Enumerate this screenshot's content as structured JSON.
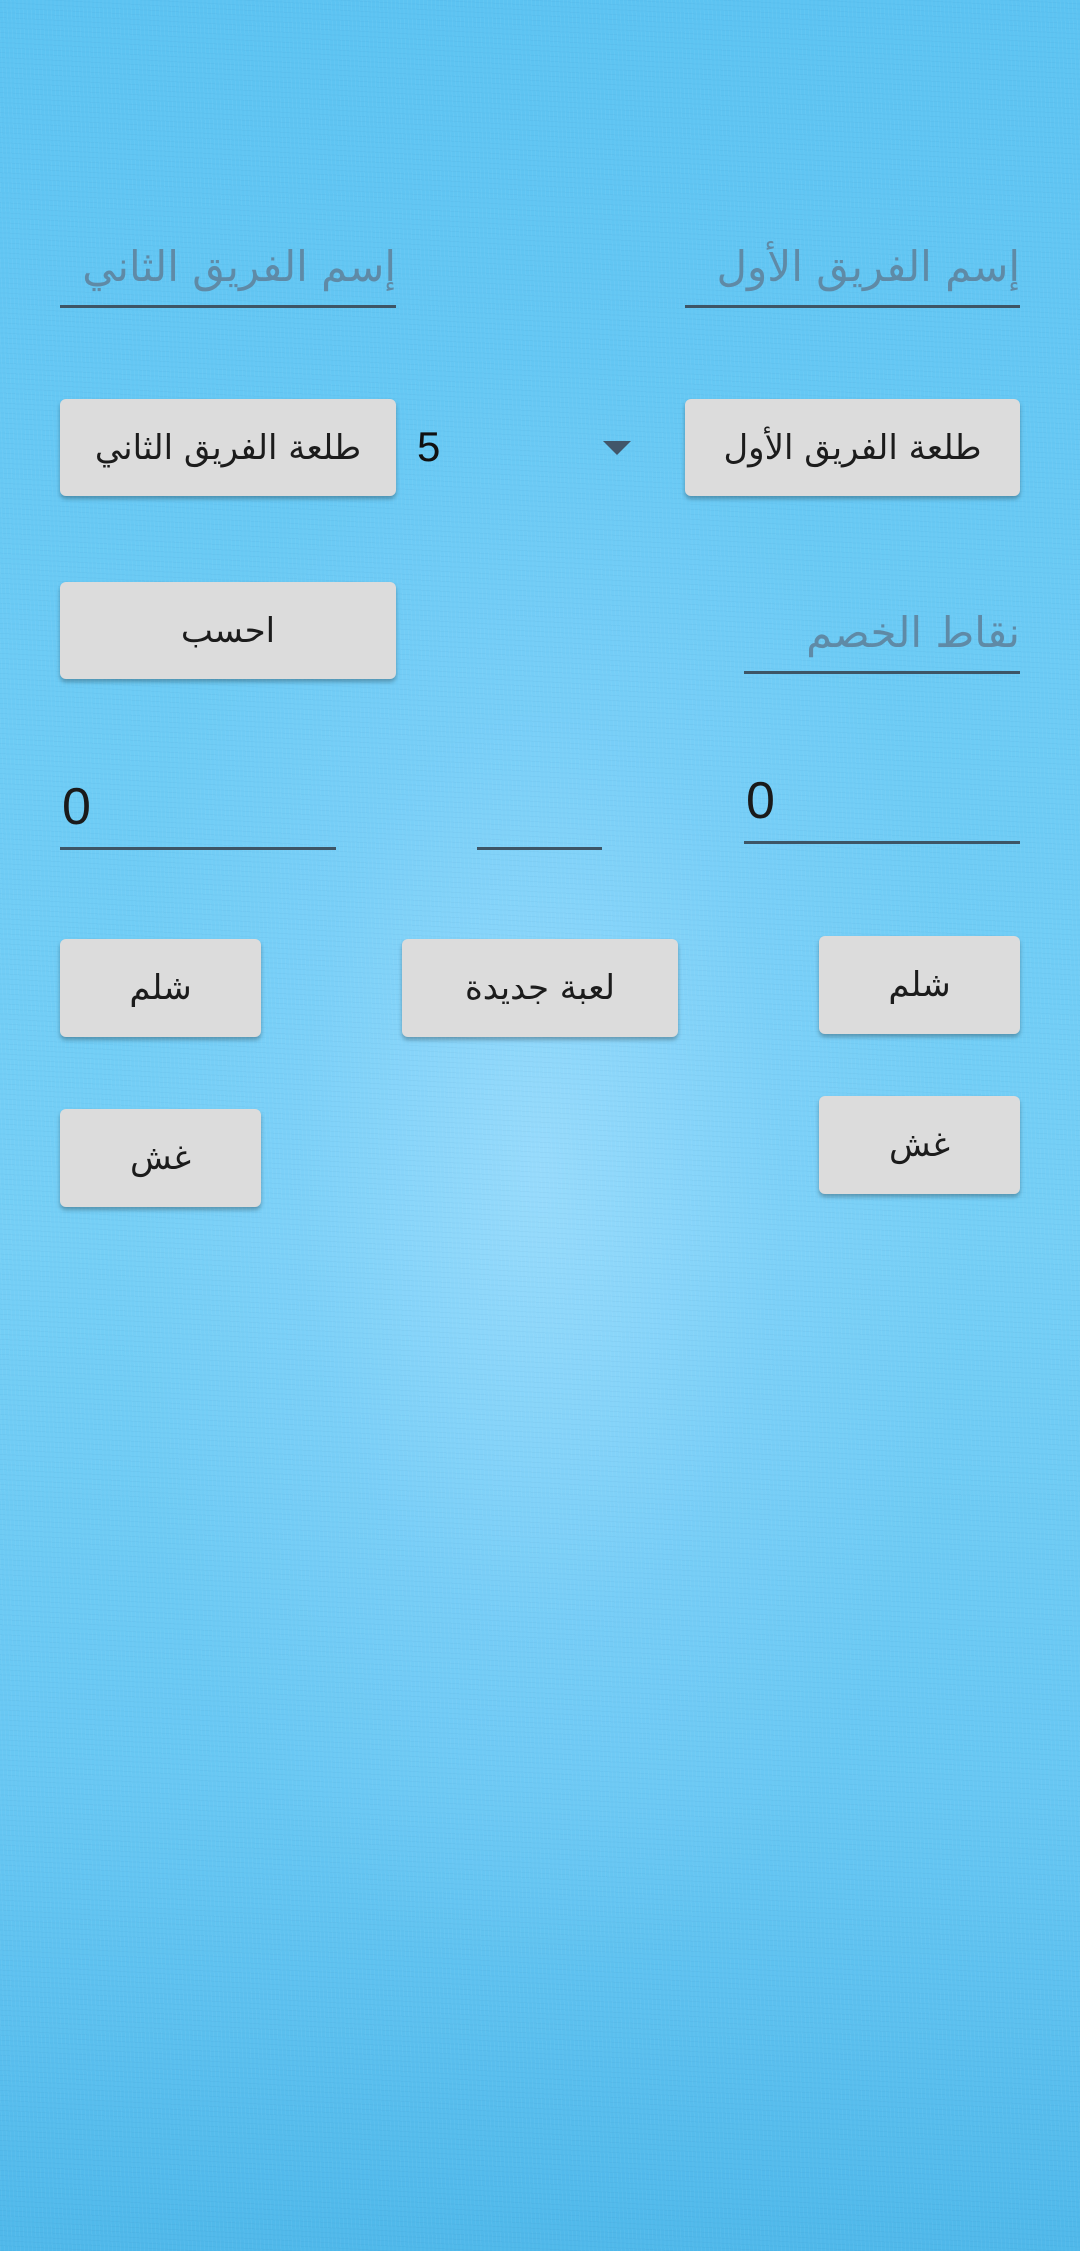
{
  "team1": {
    "name_hint": "إسم الفريق الأول",
    "serve_label": "طلعة الفريق الأول",
    "score": "0",
    "shlem_label": "شلم",
    "cheat_label": "غش"
  },
  "team2": {
    "name_hint": "إسم الفريق الثاني",
    "serve_label": "طلعة الفريق الثاني",
    "score": "0",
    "shlem_label": "شلم",
    "cheat_label": "غش"
  },
  "bid_spinner": {
    "selected": "5",
    "icon": "dropdown-arrow-icon"
  },
  "opponent_points_hint": "نقاط الخصم",
  "calculate_label": "احسب",
  "middle_field_value": "",
  "new_game_label": "لعبة جديدة",
  "colors": {
    "background": "#6ccbf5",
    "button": "#dcdcdc",
    "underline": "#3d5566",
    "hint_text": "#5f8aa6"
  }
}
